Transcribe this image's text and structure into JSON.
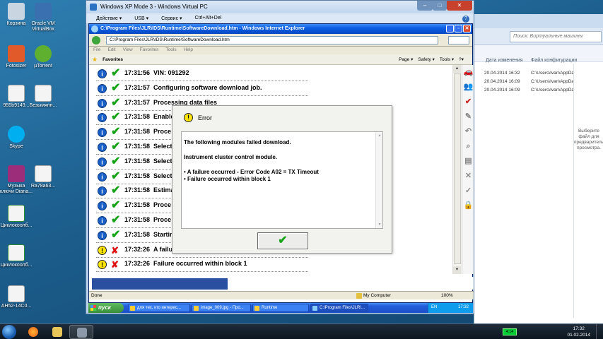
{
  "desktop": {
    "icons": [
      {
        "label": "Корзина",
        "color": "#c9d6e2"
      },
      {
        "label": "Oracle VM VirtualBox",
        "color": "#3a6fb0"
      },
      {
        "label": "Fotosizer",
        "color": "#e05a2a"
      },
      {
        "label": "µTorrent",
        "color": "#60b030"
      },
      {
        "label": "955b9149...",
        "color": "#f4f4f4"
      },
      {
        "label": "Безымянн...",
        "color": "#f4f4f4"
      },
      {
        "label": "Skype",
        "color": "#00aff0"
      },
      {
        "label": "Музыка ключи Diana...",
        "color": "#9b2d7a"
      },
      {
        "label": "Ra78a63...",
        "color": "#f4f4f4"
      },
      {
        "label": "Циклокоолб...",
        "color": "#2e8b3a"
      },
      {
        "label": "Циклокоолб...",
        "color": "#2e8b3a"
      },
      {
        "label": "AH52-14C0...",
        "color": "#f4f4f4"
      }
    ]
  },
  "explorer": {
    "search_placeholder": "Поиск: Виртуальные машины",
    "columns": {
      "modified": "Дата изменения",
      "config": "Файл конфигурации"
    },
    "rows": [
      {
        "date": "20.04.2014 16:32",
        "path": "C:\\Users\\Ivan\\AppDa"
      },
      {
        "date": "20.04.2014 16:09",
        "path": "C:\\Users\\Ivan\\AppDa"
      },
      {
        "date": "20.04.2014 16:09",
        "path": "C:\\Users\\Ivan\\AppDa"
      }
    ],
    "preview_text": "Выберите файл для предварительного просмотра."
  },
  "vpc": {
    "title": "Windows XP Mode 3 - Windows Virtual PC",
    "menu": [
      "Действие ▾",
      "USB ▾",
      "Сервис ▾",
      "Ctrl+Alt+Del"
    ],
    "help": "?"
  },
  "ie": {
    "title": "C:\\Program Files\\JLR\\IDS\\Runtime\\SoftwareDownload.htm - Windows Internet Explorer",
    "address": "C:\\Program Files\\JLR\\IDS\\Runtime\\SoftwareDownload.htm",
    "menu": [
      "File",
      "Edit",
      "View",
      "Favorites",
      "Tools",
      "Help"
    ],
    "favorites_label": "Favorites",
    "commands": [
      "Page ▾",
      "Safety ▾",
      "Tools ▾",
      "?▾"
    ],
    "status_text": "Done",
    "zone_text": "My Computer",
    "zoom_text": "100%"
  },
  "log": [
    {
      "type": "info",
      "status": "ok",
      "time": "17:31:56",
      "message": "VIN: 091292"
    },
    {
      "type": "info",
      "status": "ok",
      "time": "17:31:57",
      "message": "Configuring software download job."
    },
    {
      "type": "info",
      "status": "ok",
      "time": "17:31:57",
      "message": "Processing data files"
    },
    {
      "type": "info",
      "status": "ok",
      "time": "17:31:58",
      "message": "Enable"
    },
    {
      "type": "info",
      "status": "ok",
      "time": "17:31:58",
      "message": "Proce"
    },
    {
      "type": "info",
      "status": "ok",
      "time": "17:31:58",
      "message": "Select"
    },
    {
      "type": "info",
      "status": "ok",
      "time": "17:31:58",
      "message": "Select"
    },
    {
      "type": "info",
      "status": "ok",
      "time": "17:31:58",
      "message": "Select"
    },
    {
      "type": "info",
      "status": "ok",
      "time": "17:31:58",
      "message": "Estima"
    },
    {
      "type": "info",
      "status": "ok",
      "time": "17:31:58",
      "message": "Proce"
    },
    {
      "type": "info",
      "status": "ok",
      "time": "17:31:58",
      "message": "Proce"
    },
    {
      "type": "info",
      "status": "ok",
      "time": "17:31:58",
      "message": "Startin"
    },
    {
      "type": "warn",
      "status": "fail",
      "time": "17:32:26",
      "message": "A failu"
    },
    {
      "type": "warn",
      "status": "fail",
      "time": "17:32:26",
      "message": "Failure occurred within block 1"
    }
  ],
  "progress": {
    "fraction": 0.37
  },
  "toolbar_icons": [
    {
      "name": "vehicle-icon",
      "glyph": "🚗",
      "color": "#c22"
    },
    {
      "name": "technician-icon",
      "glyph": "👥",
      "color": "#c22"
    },
    {
      "name": "settings-check-icon",
      "glyph": "✔",
      "color": "#c22"
    },
    {
      "name": "tools-icon",
      "glyph": "✎",
      "color": "#888"
    },
    {
      "name": "undo-icon",
      "glyph": "↶",
      "color": "#888"
    },
    {
      "name": "search-icon",
      "glyph": "⌕",
      "color": "#888"
    },
    {
      "name": "document-icon",
      "glyph": "▤",
      "color": "#888"
    },
    {
      "name": "cancel-icon",
      "glyph": "✕",
      "color": "#888"
    },
    {
      "name": "tick-icon",
      "glyph": "✓",
      "color": "#888"
    },
    {
      "name": "lock-icon",
      "glyph": "🔒",
      "color": "#c22"
    }
  ],
  "dialog": {
    "title": "Error",
    "lines": [
      "The following modules failed download.",
      "Instrument cluster control module."
    ],
    "bullets": [
      "• A failure occurred - Error Code A02 = TX Timeout",
      "• Failure occurred within block 1"
    ]
  },
  "xp_taskbar": {
    "start_label": "пуск",
    "tasks": [
      "для тех, кто интерес...",
      "image_009.jpg - Про...",
      "Runtime",
      "C:\\Program Files\\JLR\\..."
    ],
    "lang": "EN",
    "clock": "17:32"
  },
  "win7_taskbar": {
    "battery": "4:14",
    "time": "17:32",
    "date": "01.02.2014"
  }
}
